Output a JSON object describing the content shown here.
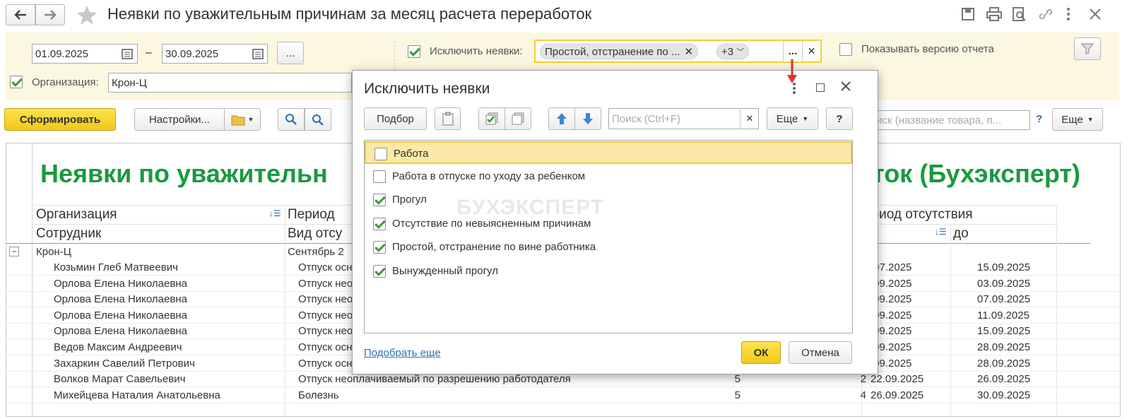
{
  "window": {
    "title": "Неявки по уважительным причинам за месяц расчета переработок"
  },
  "filters": {
    "date_from": "01.09.2025",
    "date_sep": "–",
    "date_to": "30.09.2025",
    "dots": "...",
    "exclude_label": "Исключить неявки:",
    "exclude_tag": "Простой, отстранение по ...",
    "exclude_more": "+3",
    "show_version_label": "Показывать версию отчета",
    "org_label": "Организация:",
    "org_value": "Крон-Ц"
  },
  "toolbar": {
    "generate": "Сформировать",
    "settings": "Настройки...",
    "search_placeholder": "Поиск (название товара, п...",
    "help": "?",
    "more": "Еще"
  },
  "report": {
    "title_left": "Неявки по уважительн",
    "title_right": "оток (Бухэксперт)",
    "col_org": "Организация",
    "col_period": "Период",
    "col_employee": "Сотрудник",
    "col_kind": "Вид отсу",
    "col_absence_period": "ериод отсутствия",
    "col_to": "до",
    "group_org": "Крон-Ц",
    "group_period": "Сентябрь 2",
    "rows": [
      {
        "name": "Козьмин Глеб Матвеевич",
        "kind": "Отпуск осн",
        "n1": "",
        "n2": "",
        "d1": ".07.2025",
        "d2": "15.09.2025"
      },
      {
        "name": "Орлова Елена Николаевна",
        "kind": "Отпуск нео",
        "n1": "",
        "n2": "",
        "d1": ".09.2025",
        "d2": "03.09.2025"
      },
      {
        "name": "Орлова Елена Николаевна",
        "kind": "Отпуск нео",
        "n1": "",
        "n2": "",
        "d1": ".09.2025",
        "d2": "07.09.2025"
      },
      {
        "name": "Орлова Елена Николаевна",
        "kind": "Отпуск нео",
        "n1": "",
        "n2": "",
        "d1": ".09.2025",
        "d2": "11.09.2025"
      },
      {
        "name": "Орлова Елена Николаевна",
        "kind": "Отпуск нео",
        "n1": "",
        "n2": "",
        "d1": ".09.2025",
        "d2": "15.09.2025"
      },
      {
        "name": "Ведов Максим Андреевич",
        "kind": "Отпуск осн",
        "n1": "",
        "n2": "",
        "d1": ".09.2025",
        "d2": "28.09.2025"
      },
      {
        "name": "Захаркин Савелий Петрович",
        "kind": "Отпуск осн",
        "n1": "",
        "n2": "",
        "d1": ".09.2025",
        "d2": "28.09.2025"
      },
      {
        "name": "Волков Марат Савельевич",
        "kind": "Отпуск неоплачиваемый по разрешению работодателя",
        "n1": "5",
        "n2": "2",
        "d1": "22.09.2025",
        "d2": "26.09.2025"
      },
      {
        "name": "Михейцева Наталия Анатольевна",
        "kind": "Болезнь",
        "n1": "5",
        "n2": "4",
        "d1": "26.09.2025",
        "d2": "30.09.2025"
      }
    ]
  },
  "dialog": {
    "title": "Исключить неявки",
    "pick": "Подбор",
    "search_placeholder": "Поиск (Ctrl+F)",
    "more": "Еще",
    "help": "?",
    "items": [
      {
        "label": "Работа",
        "checked": false
      },
      {
        "label": "Работа в отпуске по уходу за ребенком",
        "checked": false
      },
      {
        "label": "Прогул",
        "checked": true
      },
      {
        "label": "Отсутствие по невыясненным причинам",
        "checked": true
      },
      {
        "label": "Простой, отстранение по вине работника",
        "checked": true
      },
      {
        "label": "Вынужденный прогул",
        "checked": true
      }
    ],
    "watermark": "БУХЭКСПЕРТ",
    "pick_more": "Подобрать еще",
    "ok": "ОК",
    "cancel": "Отмена"
  },
  "colors": {
    "accent_yellow": "#f6d42b",
    "title_green": "#1a9a3e",
    "arrow_red": "#e0302f",
    "filter_bg": "#fbf7e0"
  }
}
